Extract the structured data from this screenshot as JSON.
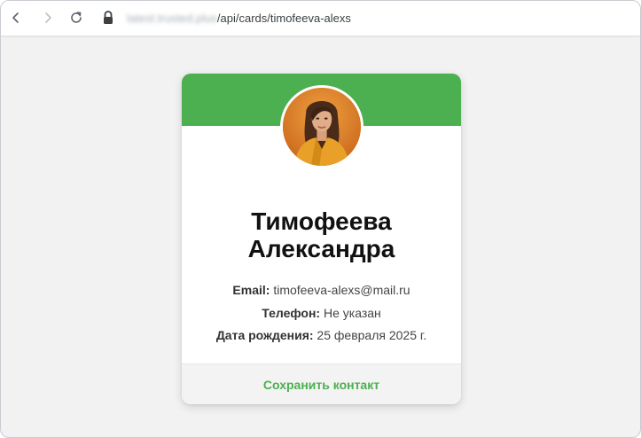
{
  "browser": {
    "url_host_blurred": "latest.trusted.plus",
    "url_path": "/api/cards/timofeeva-alexs",
    "icons": [
      "back-icon",
      "forward-icon",
      "reload-icon",
      "lock-icon"
    ]
  },
  "card": {
    "accent_color": "#4caf50",
    "avatar_alt": "avatar",
    "name_line1": "Тимофеева",
    "name_line2": "Александра",
    "email_label": "Email:",
    "email_value": "timofeeva-alexs@mail.ru",
    "phone_label": "Телефон:",
    "phone_value": "Не указан",
    "birth_label": "Дата рождения:",
    "birth_value": "25 февраля 2025 г.",
    "save_label": "Сохранить контакт"
  }
}
